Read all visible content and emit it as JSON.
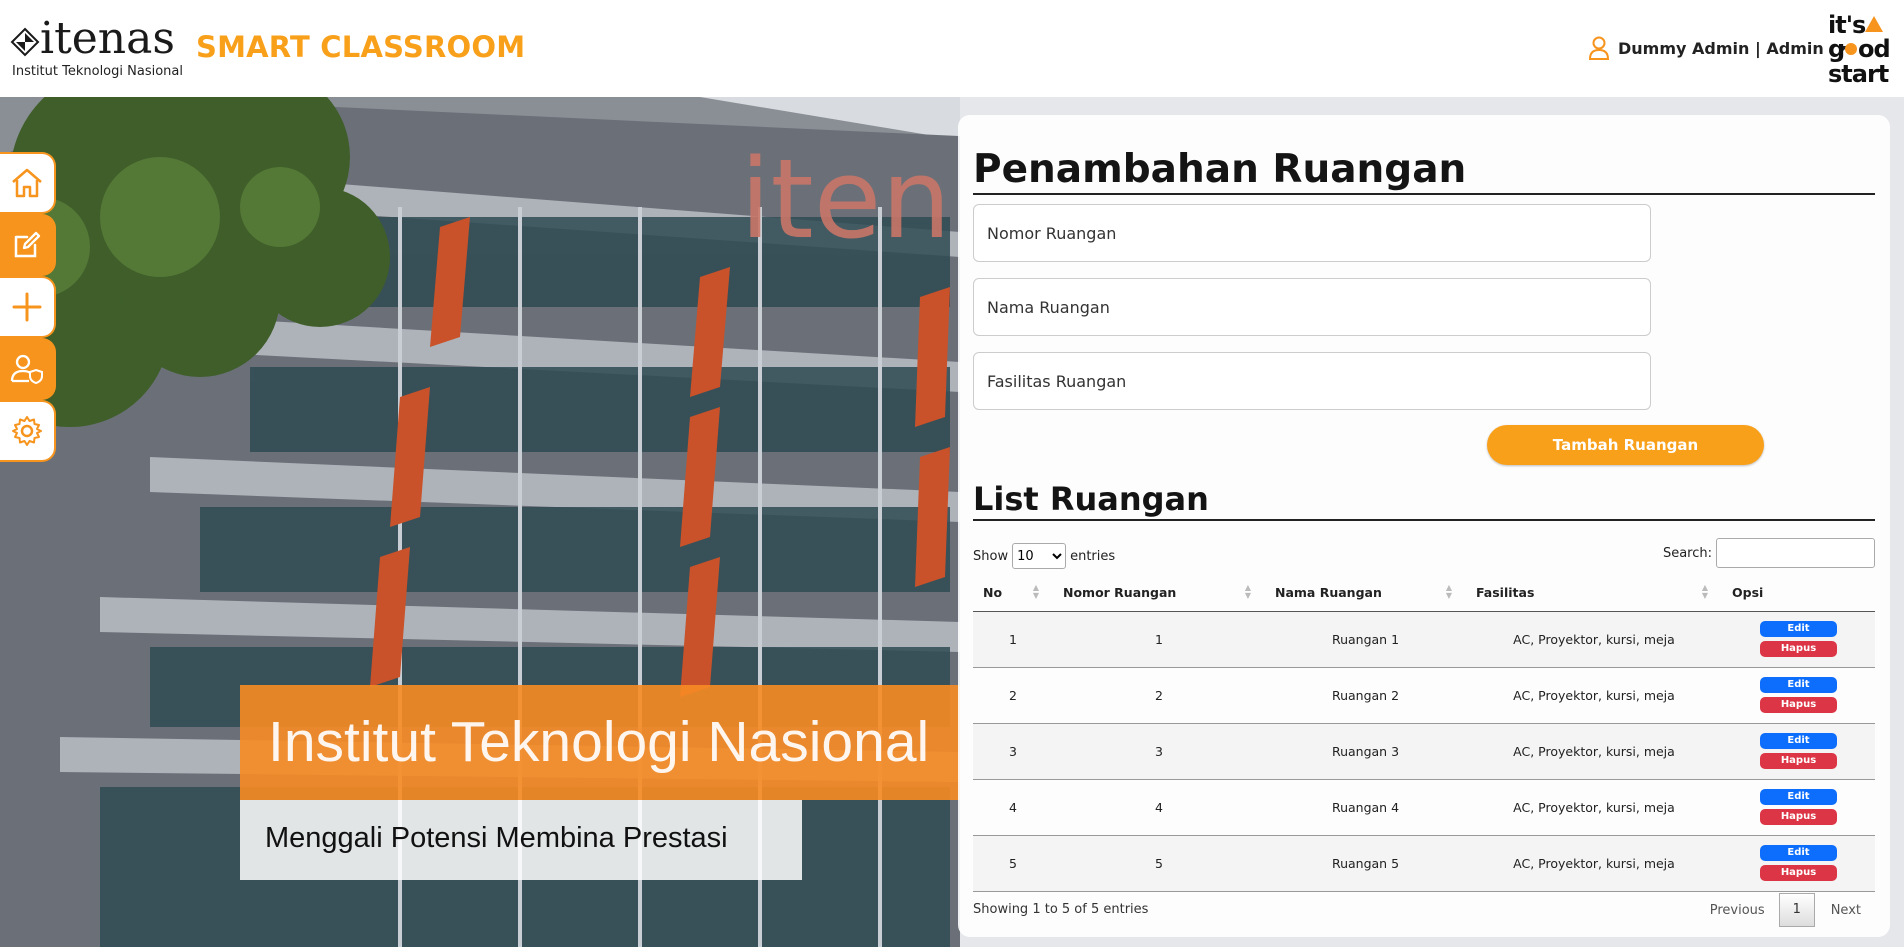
{
  "header": {
    "logo_text": "itenas",
    "logo_subtitle": "Institut Teknologi Nasional",
    "brand": "SMART CLASSROOM",
    "user": "Dummy Admin | Admin",
    "tagline": "it's good start",
    "accent_color": "#f9a01b"
  },
  "sidebar": {
    "items": [
      {
        "icon": "home-icon"
      },
      {
        "icon": "edit-icon"
      },
      {
        "icon": "plus-icon"
      },
      {
        "icon": "user-shield-icon"
      },
      {
        "icon": "gear-icon"
      }
    ]
  },
  "banner": {
    "title": "Institut Teknologi Nasional",
    "subtitle": "Menggali Potensi Membina Prestasi"
  },
  "form": {
    "title": "Penambahan Ruangan",
    "nomor_placeholder": "Nomor Ruangan",
    "nama_placeholder": "Nama Ruangan",
    "fasilitas_placeholder": "Fasilitas Ruangan",
    "submit_label": "Tambah Ruangan"
  },
  "list": {
    "title": "List Ruangan",
    "show_label": "Show",
    "entries_label": "entries",
    "page_length": "10",
    "search_label": "Search:",
    "columns": [
      "No",
      "Nomor Ruangan",
      "Nama Ruangan",
      "Fasilitas",
      "Opsi"
    ],
    "rows": [
      {
        "no": "1",
        "nomor": "1",
        "nama": "Ruangan 1",
        "fasilitas": "AC, Proyektor, kursi, meja"
      },
      {
        "no": "2",
        "nomor": "2",
        "nama": "Ruangan 2",
        "fasilitas": "AC, Proyektor, kursi, meja"
      },
      {
        "no": "3",
        "nomor": "3",
        "nama": "Ruangan 3",
        "fasilitas": "AC, Proyektor, kursi, meja"
      },
      {
        "no": "4",
        "nomor": "4",
        "nama": "Ruangan 4",
        "fasilitas": "AC, Proyektor, kursi, meja"
      },
      {
        "no": "5",
        "nomor": "5",
        "nama": "Ruangan 5",
        "fasilitas": "AC, Proyektor, kursi, meja"
      }
    ],
    "edit_label": "Edit",
    "delete_label": "Hapus",
    "info": "Showing 1 to 5 of 5 entries",
    "prev_label": "Previous",
    "page": "1",
    "next_label": "Next"
  }
}
